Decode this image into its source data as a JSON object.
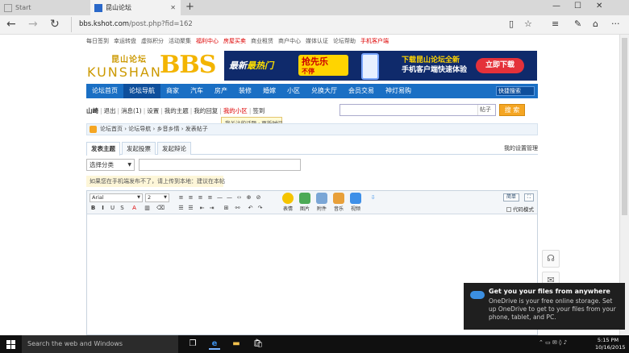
{
  "tabs": [
    {
      "title": "Start"
    },
    {
      "title": "昆山论坛"
    }
  ],
  "address": {
    "url_host": "bbs.kshot.com",
    "url_path": "/post.php?fid=162"
  },
  "top_links": [
    {
      "text": "每日签到",
      "red": false
    },
    {
      "text": "幸运转盘",
      "red": false
    },
    {
      "text": "虚拟积分",
      "red": false
    },
    {
      "text": "活动聚集",
      "red": false
    },
    {
      "text": "福利中心",
      "red": true
    },
    {
      "text": "房屋买卖",
      "red": true
    },
    {
      "text": "商业租赁",
      "red": false
    },
    {
      "text": "商户中心",
      "red": false
    },
    {
      "text": "媒体认证",
      "red": false
    },
    {
      "text": "论坛帮助",
      "red": false
    },
    {
      "text": "手机客户端",
      "red": true
    }
  ],
  "logo": {
    "cn": "昆山论坛",
    "en": "KUNSHAN",
    "bbs": "BBS"
  },
  "banner": {
    "left1": "最新",
    "left2": "最热门",
    "promo_line1": "抢先乐",
    "promo_line2": "不停",
    "right_line1": "下载昆山论坛全新",
    "right_line2": "手机客户端快速体验",
    "download": "立即下载"
  },
  "main_nav": [
    "论坛首页",
    "论坛导航",
    "商家",
    "汽车",
    "房产",
    "装修",
    "婚嫁",
    "小区",
    "兑换大厅",
    "会员交易",
    "神灯易购"
  ],
  "main_nav_search": "快捷搜索",
  "user_bar": {
    "items": [
      "山崎",
      "退出",
      "消息(1)",
      "设置",
      "我的主题",
      "我的回复",
      "我的小区",
      "签到"
    ],
    "search_scope": "帖子",
    "search_button": "搜 索"
  },
  "tooltip": {
    "text": "我关注的话题 · 更新时间",
    "close": "×"
  },
  "breadcrumb": "论坛首页 › 论坛导航 › 乡音乡情 › 发表帖子",
  "post_tabs": [
    "发表主题",
    "发起投票",
    "发起辩论"
  ],
  "post_tabs_right": "我的设置管理",
  "category": {
    "selected": "选择分类"
  },
  "hint": "如果您在手机端发布不了，请上传到本地：建议在本帖",
  "editor": {
    "font": "Arial",
    "size": "2",
    "big_tools": [
      "表情",
      "图片",
      "附件",
      "音乐",
      "视频"
    ],
    "simple": "简单",
    "code_mode": "代码模式"
  },
  "toast": {
    "title": "Get you your files from anywhere",
    "body": "OneDrive is your free online storage. Set up OneDrive to get to your files from your phone, tablet, and PC."
  },
  "taskbar": {
    "search_placeholder": "Search the web and Windows",
    "time": "5:15 PM",
    "date": "10/16/2015"
  }
}
